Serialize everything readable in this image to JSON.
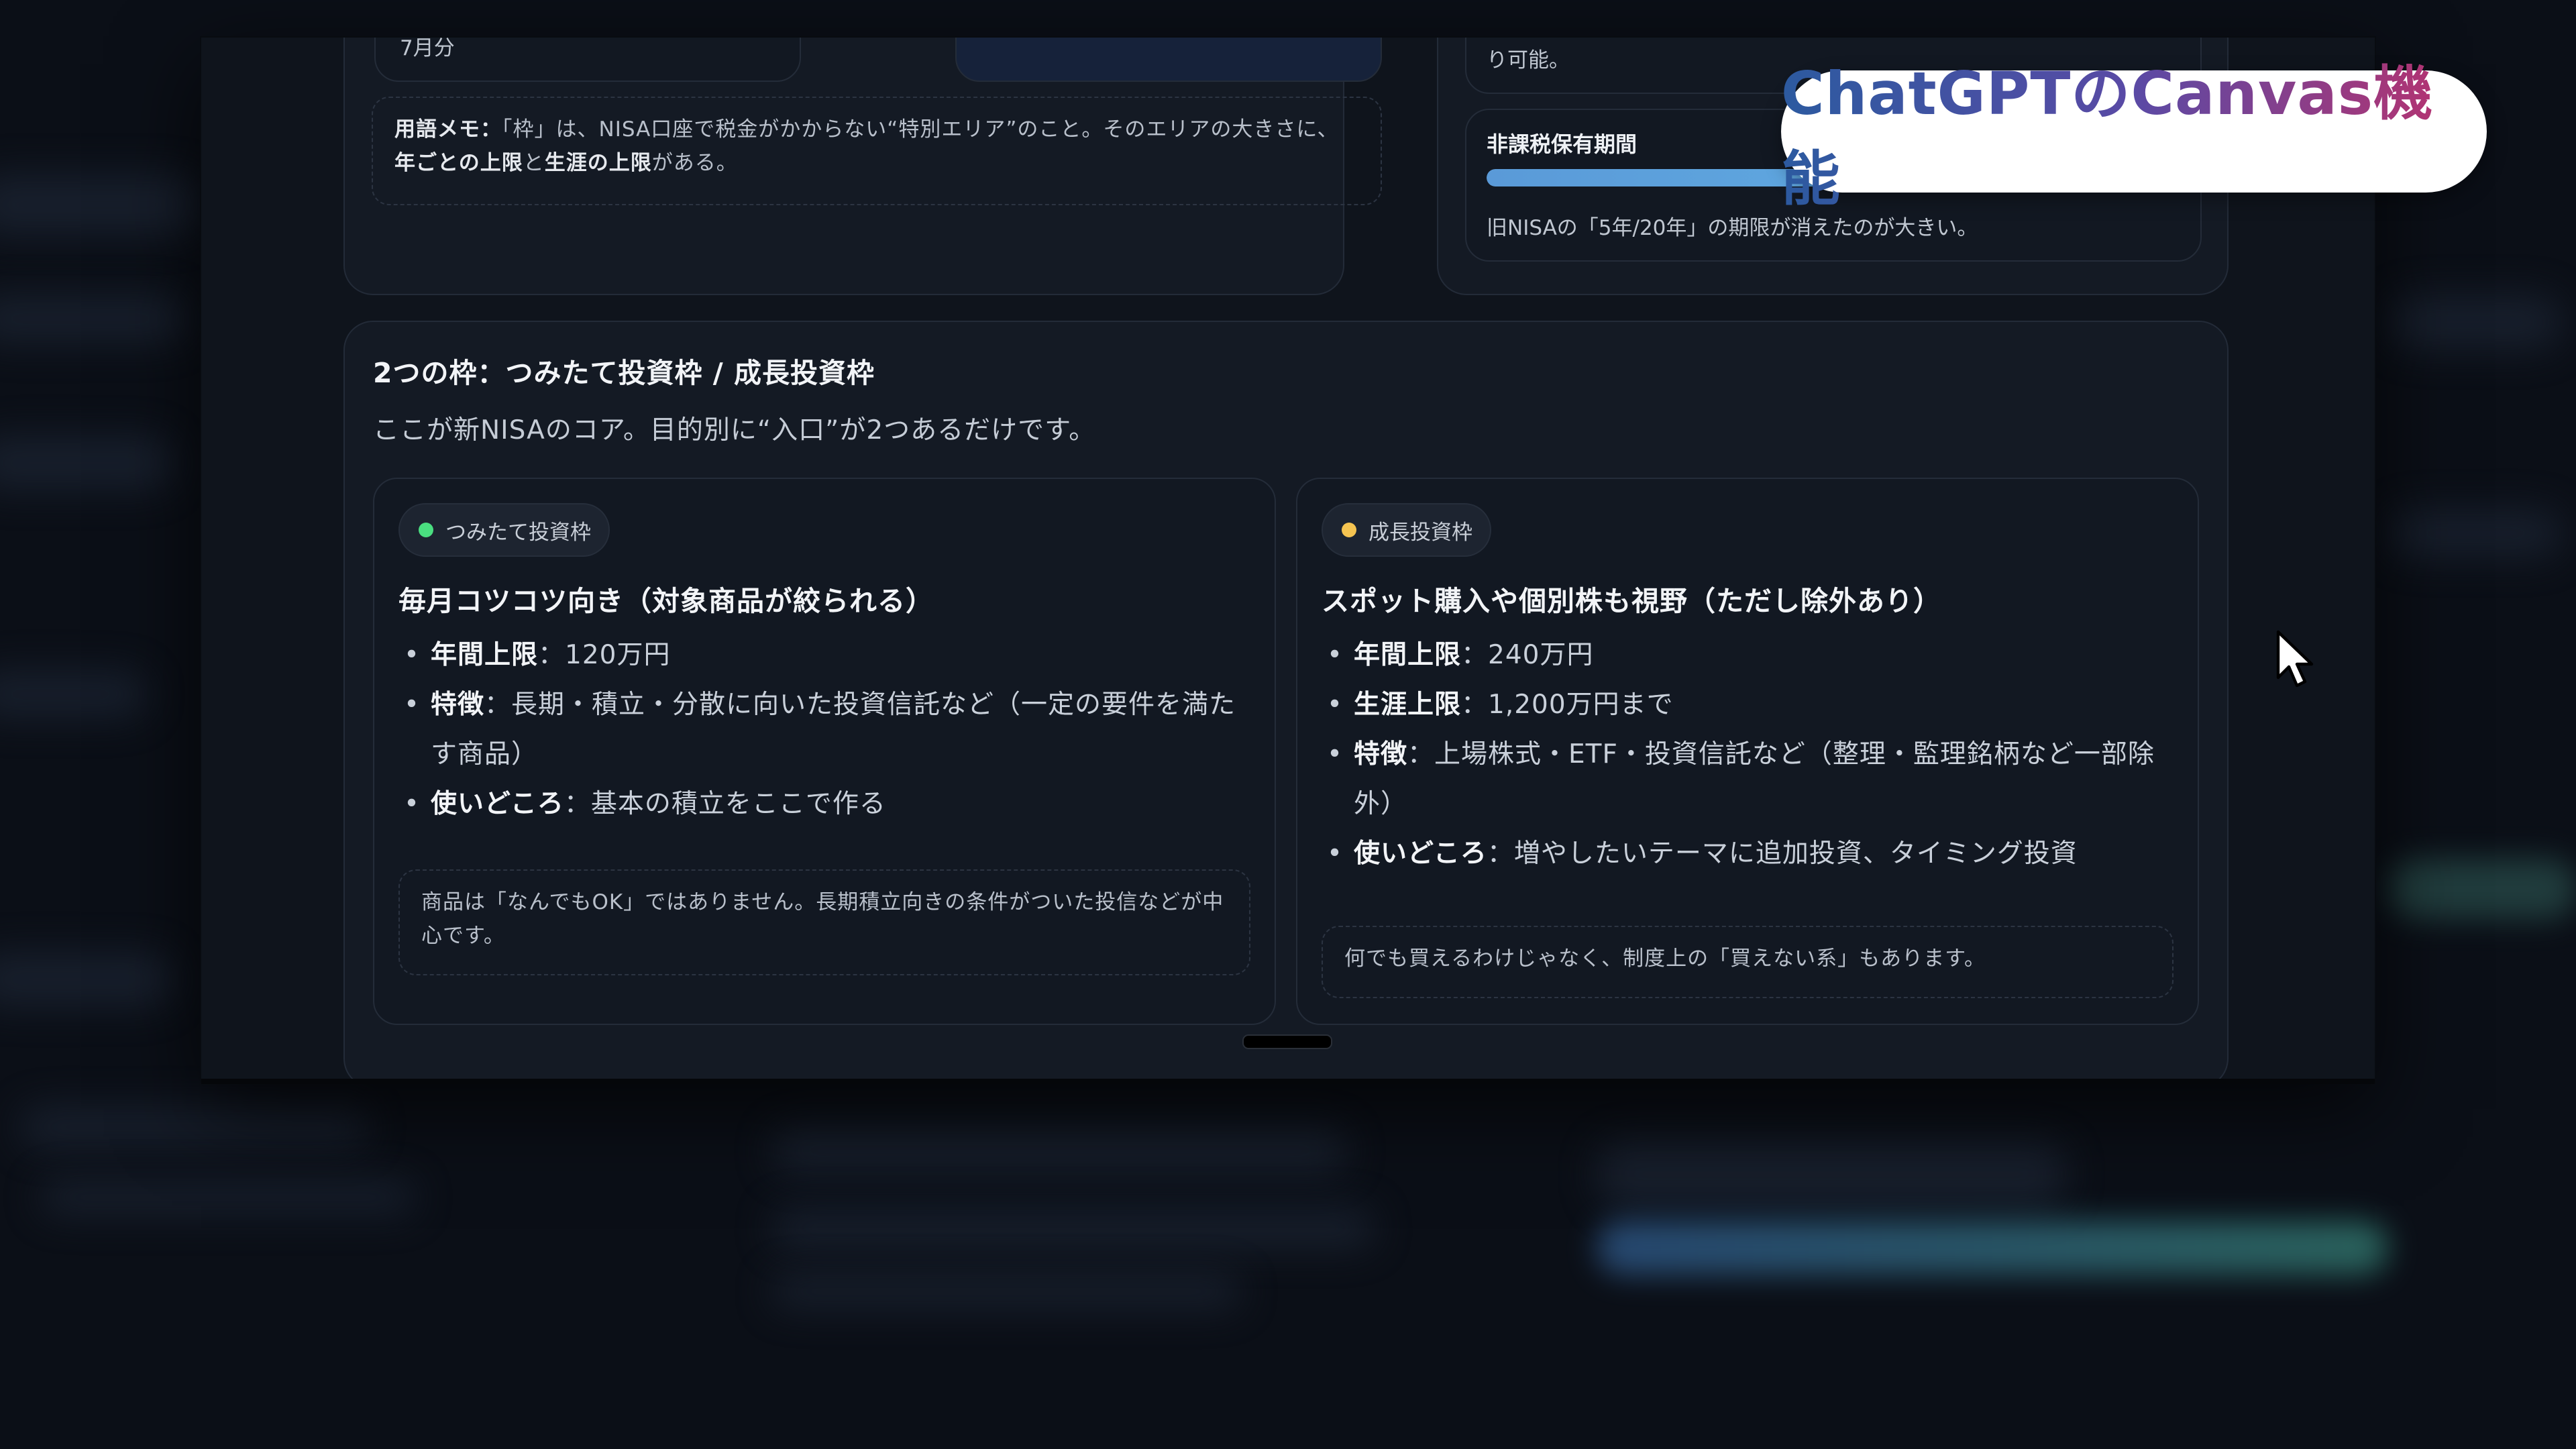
{
  "overlay": {
    "title": "ChatGPTのCanvas機能"
  },
  "top_left_card": {
    "clipped_text": "7月分",
    "note_label": "用語メモ：",
    "note_text": "「枠」は、NISA口座で税金がかからない“特別エリア”のこと。そのエリアの大きさに、",
    "note_bold_a": "年ごとの上限",
    "note_and": "と",
    "note_bold_b": "生涯の上限",
    "note_end": "がある。"
  },
  "top_right_card": {
    "clipped_text": "り可能。",
    "period_label": "非課税保有期間",
    "period_progress": 1.0,
    "period_note": "旧NISAの「5年/20年」の期限が消えたのが大きい。"
  },
  "main_section": {
    "title": "2つの枠：つみたて投資枠 / 成長投資枠",
    "subtitle": "ここが新NISAのコア。目的別に“入口”が2つあるだけです。",
    "tsumitate": {
      "tag": "つみたて投資枠",
      "tag_color": "#4ade80",
      "heading": "毎月コツコツ向き（対象商品が絞られる）",
      "items": [
        {
          "label": "年間上限",
          "sep": "：",
          "value": "120万円"
        },
        {
          "label": "特徴",
          "sep": "：",
          "value": "長期・積立・分散に向いた投資信託など（一定の要件を満たす商品）"
        },
        {
          "label": "使いどころ",
          "sep": "：",
          "value": "基本の積立をここで作る"
        }
      ],
      "note": "商品は「なんでもOK」ではありません。長期積立向きの条件がついた投信などが中心です。"
    },
    "seicho": {
      "tag": "成長投資枠",
      "tag_color": "#f5c451",
      "heading": "スポット購入や個別株も視野（ただし除外あり）",
      "items": [
        {
          "label": "年間上限",
          "sep": "：",
          "value": "240万円"
        },
        {
          "label": "生涯上限",
          "sep": "：",
          "value": "1,200万円まで"
        },
        {
          "label": "特徴",
          "sep": "：",
          "value": "上場株式・ETF・投資信託など（整理・監理銘柄など一部除外）"
        },
        {
          "label": "使いどころ",
          "sep": "：",
          "value": "増やしたいテーマに追加投資、タイミング投資"
        }
      ],
      "note": "何でも買えるわけじゃなく、制度上の「買えない系」もあります。"
    }
  }
}
